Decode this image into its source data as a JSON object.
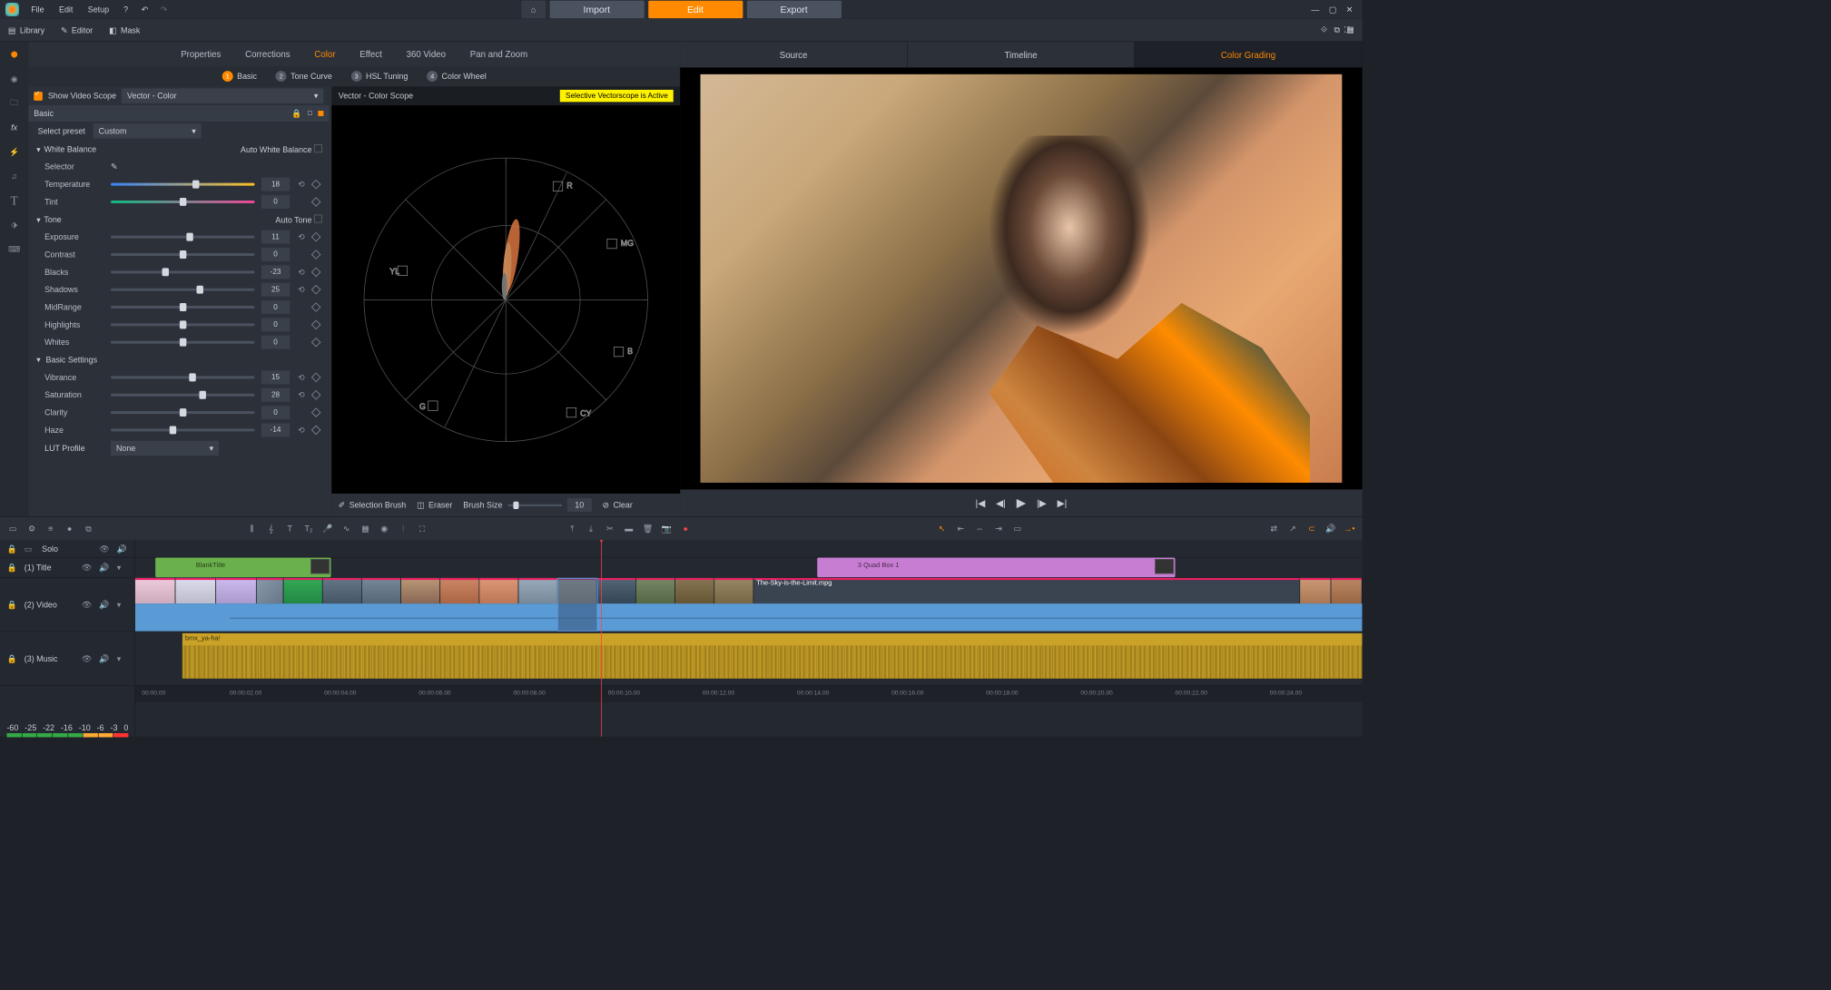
{
  "menubar": {
    "file": "File",
    "edit": "Edit",
    "setup": "Setup"
  },
  "top_buttons": {
    "import": "Import",
    "edit": "Edit",
    "export": "Export"
  },
  "view_tabs": {
    "library": "Library",
    "editor": "Editor",
    "mask": "Mask"
  },
  "editor_tabs": {
    "properties": "Properties",
    "corrections": "Corrections",
    "color": "Color",
    "effect": "Effect",
    "video360": "360 Video",
    "panzoom": "Pan and Zoom"
  },
  "sub_tabs": {
    "basic": "Basic",
    "tonecurve": "Tone Curve",
    "hsl": "HSL Tuning",
    "colorwheel": "Color Wheel"
  },
  "scope_toggle": {
    "label": "Show Video Scope",
    "selected": "Vector - Color"
  },
  "scope_header": {
    "title": "Vector - Color Scope",
    "notice": "Selective Vectorscope is Active"
  },
  "basic_panel": {
    "title": "Basic",
    "preset_label": "Select preset",
    "preset_value": "Custom"
  },
  "white_balance": {
    "title": "White Balance",
    "auto": "Auto White Balance",
    "selector": "Selector",
    "temperature": "Temperature",
    "temperature_val": "18",
    "tint": "Tint",
    "tint_val": "0"
  },
  "tone": {
    "title": "Tone",
    "auto": "Auto Tone",
    "exposure": "Exposure",
    "exposure_val": "11",
    "contrast": "Contrast",
    "contrast_val": "0",
    "blacks": "Blacks",
    "blacks_val": "-23",
    "shadows": "Shadows",
    "shadows_val": "25",
    "midrange": "MidRange",
    "midrange_val": "0",
    "highlights": "Highlights",
    "highlights_val": "0",
    "whites": "Whites",
    "whites_val": "0"
  },
  "basic_settings": {
    "title": "Basic Settings",
    "vibrance": "Vibrance",
    "vibrance_val": "15",
    "saturation": "Saturation",
    "saturation_val": "28",
    "clarity": "Clarity",
    "clarity_val": "0",
    "haze": "Haze",
    "haze_val": "-14",
    "lut": "LUT Profile",
    "lut_val": "None"
  },
  "scope_tools": {
    "brush": "Selection Brush",
    "eraser": "Eraser",
    "size_label": "Brush Size",
    "size_val": "10",
    "clear": "Clear"
  },
  "preview_tabs": {
    "source": "Source",
    "timeline": "Timeline",
    "grading": "Color Grading"
  },
  "tracks": {
    "solo": "Solo",
    "title": "(1) Title",
    "video": "(2) Video",
    "music": "(3) Music"
  },
  "clips": {
    "title1": "BlankTitle",
    "title2": "3 Quad Box 1",
    "video_file": "The-Sky-is-the-Limit.mpg",
    "music": "bmx_ya-ha!"
  },
  "timecodes": [
    "00:00.00",
    "00:00:02.00",
    "00:00:04.00",
    "00:00:06.00",
    "00:00:08.00",
    "00:00:10.00",
    "00:00:12.00",
    "00:00:14.00",
    "00:00:16.00",
    "00:00:18.00",
    "00:00:20.00",
    "00:00:22.00",
    "00:00:24.00"
  ],
  "meter_scale": [
    "-60",
    "-25",
    "-22",
    "-16",
    "-10",
    "-6",
    "-3",
    "0"
  ],
  "vectorscope_labels": {
    "r": "R",
    "mg": "MG",
    "b": "B",
    "cy": "CY",
    "g": "G",
    "yl": "YL"
  }
}
